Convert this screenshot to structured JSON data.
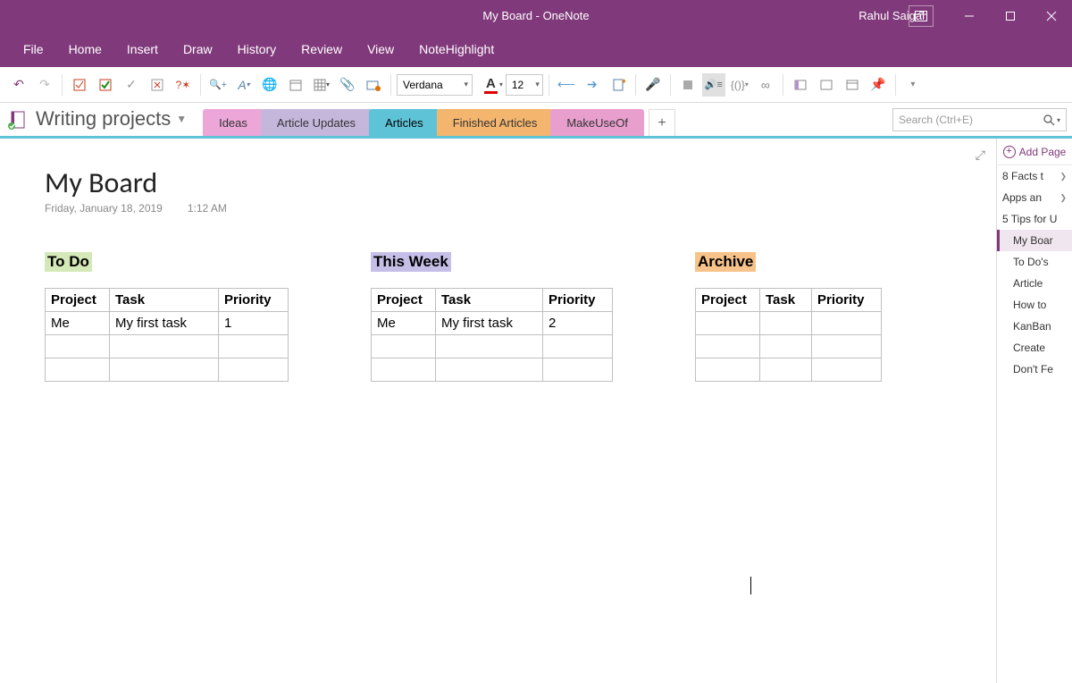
{
  "titlebar": {
    "title": "My Board  -  OneNote",
    "user": "Rahul Saigal"
  },
  "menu": [
    "File",
    "Home",
    "Insert",
    "Draw",
    "History",
    "Review",
    "View",
    "NoteHighlight"
  ],
  "ribbon": {
    "font": "Verdana",
    "size": "12"
  },
  "nav": {
    "notebook": "Writing projects",
    "sections": {
      "ideas": "Ideas",
      "updates": "Article Updates",
      "articles": "Articles",
      "finished": "Finished Articles",
      "muo": "MakeUseOf"
    },
    "search_placeholder": "Search (Ctrl+E)"
  },
  "page": {
    "title": "My Board",
    "date": "Friday, January 18, 2019",
    "time": "1:12 AM"
  },
  "boards": {
    "todo": {
      "label": "To Do",
      "cols": [
        "Project",
        "Task",
        "Priority"
      ],
      "rows": [
        [
          "Me",
          "My first task",
          "1"
        ],
        [
          "",
          "",
          ""
        ],
        [
          "",
          "",
          ""
        ]
      ]
    },
    "week": {
      "label": "This Week",
      "cols": [
        "Project",
        "Task",
        "Priority"
      ],
      "rows": [
        [
          "Me",
          "My first task",
          "2"
        ],
        [
          "",
          "",
          ""
        ],
        [
          "",
          "",
          ""
        ]
      ]
    },
    "archive": {
      "label": "Archive",
      "cols": [
        "Project",
        "Task",
        "Priority"
      ],
      "rows": [
        [
          "",
          "",
          ""
        ],
        [
          "",
          "",
          ""
        ],
        [
          "",
          "",
          ""
        ]
      ]
    }
  },
  "sidepanel": {
    "addpage": "Add Page",
    "pages": [
      {
        "label": "8 Facts t",
        "chev": true
      },
      {
        "label": "Apps an",
        "chev": true
      },
      {
        "label": "5 Tips for U"
      },
      {
        "label": "My Boar",
        "indent": true,
        "active": true
      },
      {
        "label": "To Do's",
        "indent": true
      },
      {
        "label": "Article",
        "indent": true
      },
      {
        "label": "How to",
        "indent": true
      },
      {
        "label": "KanBan",
        "indent": true
      },
      {
        "label": "Create",
        "indent": true
      },
      {
        "label": "Don't Fe",
        "indent": true
      }
    ]
  }
}
